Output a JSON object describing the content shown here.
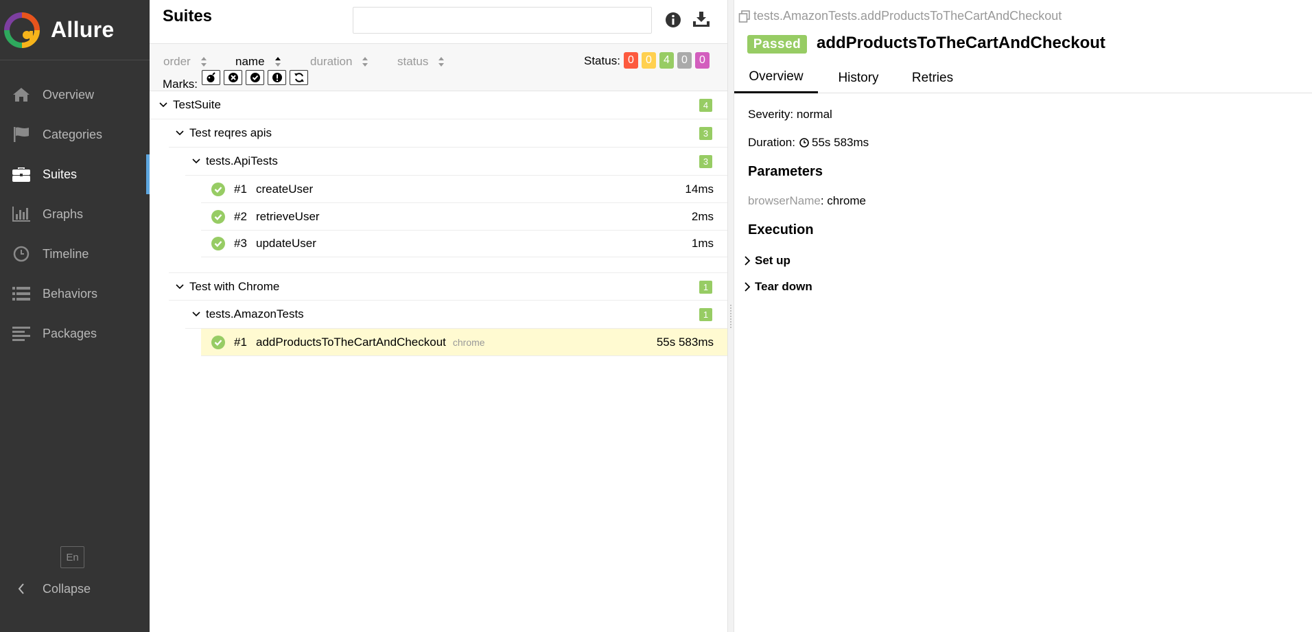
{
  "app": {
    "brand": "Allure"
  },
  "sidebar": {
    "items": [
      {
        "label": "Overview",
        "icon": "home-icon",
        "active": false
      },
      {
        "label": "Categories",
        "icon": "flag-icon",
        "active": false
      },
      {
        "label": "Suites",
        "icon": "briefcase-icon",
        "active": true
      },
      {
        "label": "Graphs",
        "icon": "bar-chart-icon",
        "active": false
      },
      {
        "label": "Timeline",
        "icon": "clock-icon",
        "active": false
      },
      {
        "label": "Behaviors",
        "icon": "list-icon",
        "active": false
      },
      {
        "label": "Packages",
        "icon": "align-left-icon",
        "active": false
      }
    ],
    "language": "En",
    "collapse_label": "Collapse"
  },
  "suites": {
    "title": "Suites",
    "search": {
      "value": "",
      "placeholder": ""
    },
    "sort": {
      "order": "order",
      "name": "name",
      "duration": "duration",
      "status": "status"
    },
    "status_label": "Status:",
    "status_counts": [
      {
        "value": "0",
        "color": "#fd5a3e"
      },
      {
        "value": "0",
        "color": "#ffd050"
      },
      {
        "value": "4",
        "color": "#97cc64"
      },
      {
        "value": "0",
        "color": "#aaaaaa"
      },
      {
        "value": "0",
        "color": "#d35ebe"
      }
    ],
    "marks_label": "Marks:",
    "tree": {
      "root": {
        "name": "TestSuite",
        "count": "4"
      },
      "group1": {
        "name": "Test reqres apis",
        "count": "3"
      },
      "class1": {
        "name": "tests.ApiTests",
        "count": "3"
      },
      "tests1": [
        {
          "num": "#1",
          "name": "createUser",
          "duration": "14ms"
        },
        {
          "num": "#2",
          "name": "retrieveUser",
          "duration": "2ms"
        },
        {
          "num": "#3",
          "name": "updateUser",
          "duration": "1ms"
        }
      ],
      "group2": {
        "name": "Test with Chrome",
        "count": "1"
      },
      "class2": {
        "name": "tests.AmazonTests",
        "count": "1"
      },
      "tests2": [
        {
          "num": "#1",
          "name": "addProductsToTheCartAndCheckout",
          "param": "chrome",
          "duration": "55s 583ms"
        }
      ]
    }
  },
  "detail": {
    "fullname": "tests.AmazonTests.addProductsToTheCartAndCheckout",
    "status": "Passed",
    "title": "addProductsToTheCartAndCheckout",
    "tabs": [
      "Overview",
      "History",
      "Retries"
    ],
    "severity": "Severity: normal",
    "duration_label": "Duration:",
    "duration_value": "55s 583ms",
    "parameters_title": "Parameters",
    "param_name": "browserName",
    "param_value": ": chrome",
    "execution_title": "Execution",
    "setup_label": "Set up",
    "teardown_label": "Tear down"
  }
}
